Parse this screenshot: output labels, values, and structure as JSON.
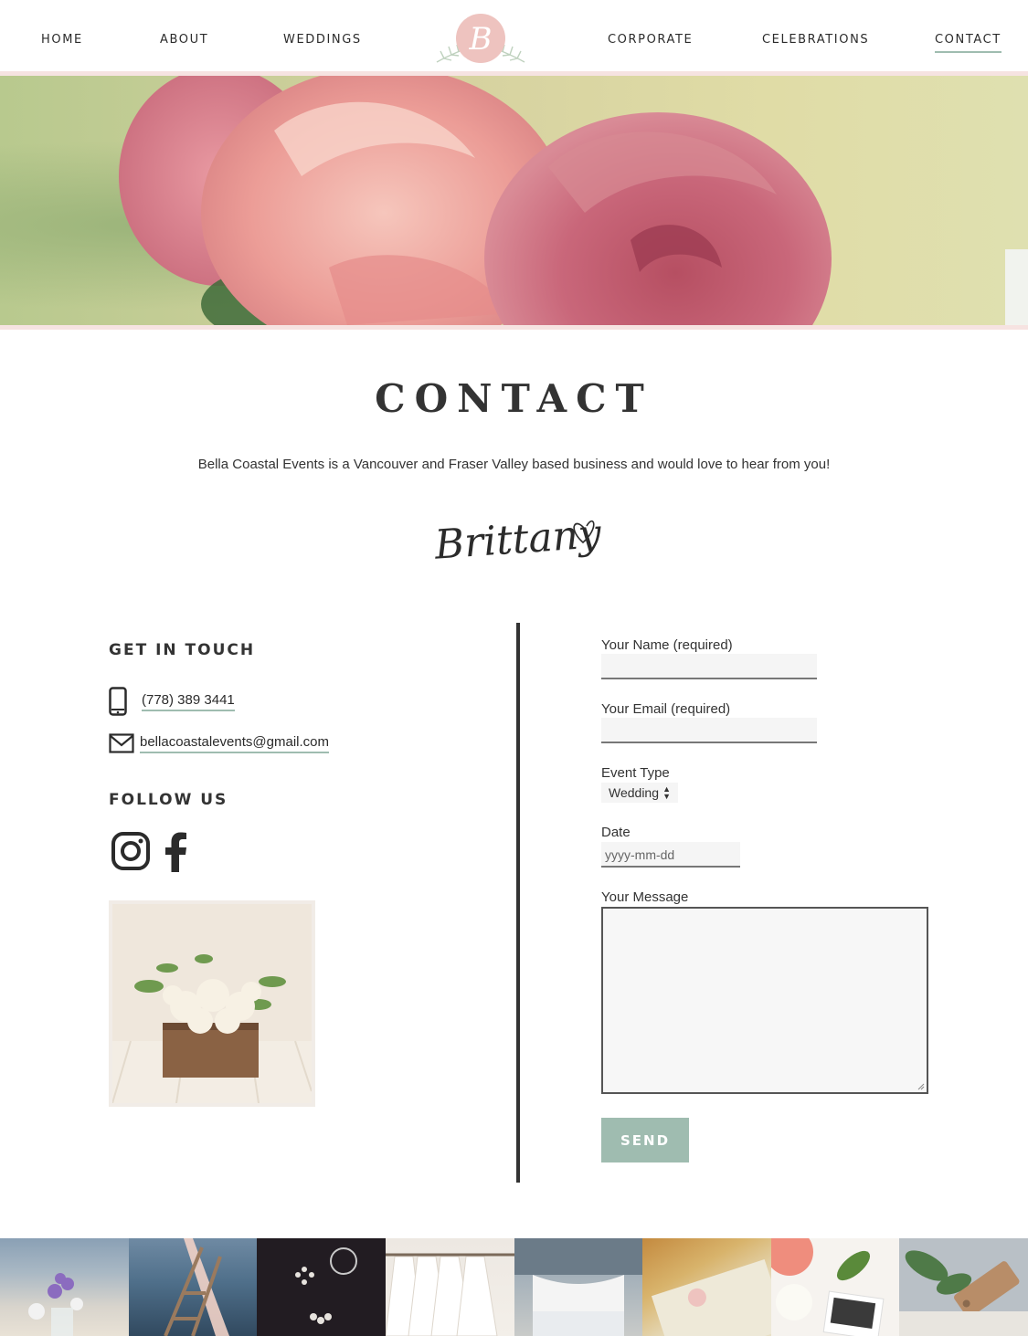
{
  "nav": {
    "items": [
      {
        "label": "HOME",
        "active": false
      },
      {
        "label": "ABOUT",
        "active": false
      },
      {
        "label": "WEDDINGS",
        "active": false
      },
      {
        "label": "CORPORATE",
        "active": false
      },
      {
        "label": "CELEBRATIONS",
        "active": false
      },
      {
        "label": "CONTACT",
        "active": true
      }
    ],
    "logo_letter": "B"
  },
  "page": {
    "title": "CONTACT",
    "intro": "Bella Coastal Events is a Vancouver and Fraser Valley based business and would love to hear from you!",
    "signature": "Brittany"
  },
  "get_in_touch": {
    "title": "GET IN TOUCH",
    "phone": "(778) 389 3441",
    "email": "bellacoastalevents@gmail.com",
    "phone_icon": "phone-icon",
    "email_icon": "envelope-icon"
  },
  "follow_us": {
    "title": "FOLLOW US",
    "icons": [
      "instagram-icon",
      "facebook-icon"
    ]
  },
  "form": {
    "name_label": "Your Name (required)",
    "email_label": "Your Email (required)",
    "event_type_label": "Event Type",
    "event_type_value": "Wedding",
    "date_label": "Date",
    "date_placeholder": "yyyy-mm-dd",
    "message_label": "Your Message",
    "send_label": "SEND"
  },
  "colors": {
    "accent": "#9fbcb0",
    "pink_strip": "#f6e3e1",
    "logo_pink": "#eec3bf",
    "text": "#2f2f2f"
  }
}
